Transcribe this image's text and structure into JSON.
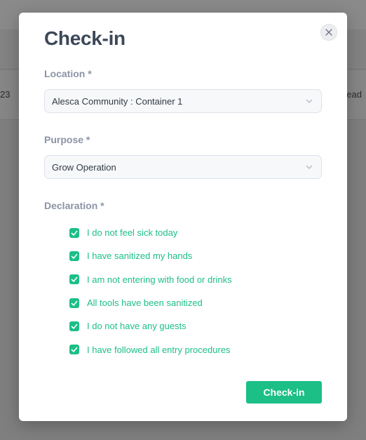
{
  "background": {
    "left_fragment": "23",
    "right_fragment": "ead"
  },
  "modal": {
    "title": "Check-in",
    "close_icon": "close-icon",
    "location": {
      "label": "Location *",
      "value": "Alesca Community : Container 1"
    },
    "purpose": {
      "label": "Purpose *",
      "value": "Grow Operation"
    },
    "declaration": {
      "label": "Declaration *",
      "items": [
        {
          "label": "I do not feel sick today",
          "checked": true
        },
        {
          "label": "I have sanitized my hands",
          "checked": true
        },
        {
          "label": "I am not entering with food or drinks",
          "checked": true
        },
        {
          "label": "All tools have been sanitized",
          "checked": true
        },
        {
          "label": "I do not have any guests",
          "checked": true
        },
        {
          "label": "I have followed all entry procedures",
          "checked": true
        }
      ]
    },
    "submit_label": "Check-in"
  },
  "colors": {
    "accent": "#1cbf86",
    "title": "#3c4858",
    "label": "#8a94a6",
    "overlay": "#7f7f7f"
  }
}
